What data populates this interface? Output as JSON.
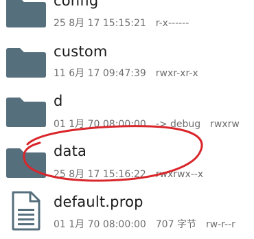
{
  "files": [
    {
      "name": "config",
      "type": "folder",
      "date": "25 8月 17 15:15:21",
      "perms": "r-x------",
      "extra": ""
    },
    {
      "name": "custom",
      "type": "folder",
      "date": "11 6月 17 09:47:39",
      "perms": "rwxr-xr-x",
      "extra": ""
    },
    {
      "name": "d",
      "type": "folder",
      "date": "01 1月 70 08:00:00",
      "perms": "rwxrw",
      "extra": "-> debug"
    },
    {
      "name": "data",
      "type": "folder",
      "date": "25 8月 17 15:16:22",
      "perms": "rwxrwx--x",
      "extra": ""
    },
    {
      "name": "default.prop",
      "type": "file",
      "date": "01 1月 70 08:00:00",
      "perms": "rw-r--r",
      "extra": "707 字节"
    }
  ],
  "colors": {
    "folder": "#566f7d",
    "file": "#566f7d",
    "annotation": "#d9262b"
  },
  "icons": {
    "folder": "folder-icon",
    "file": "document-icon"
  }
}
